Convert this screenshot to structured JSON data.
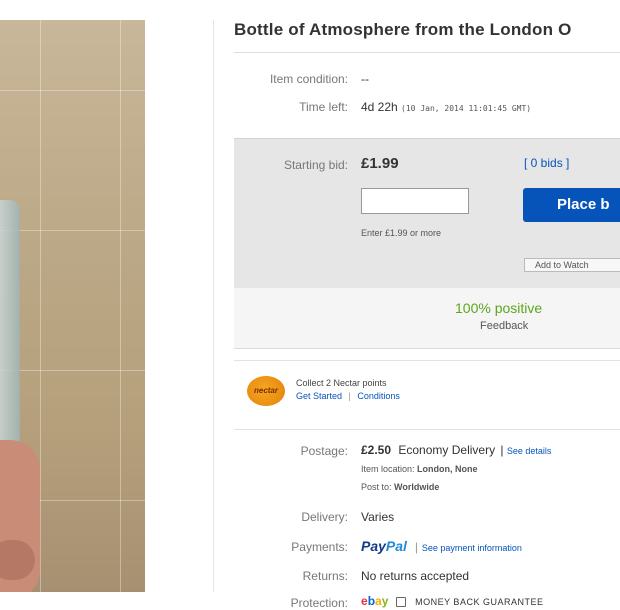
{
  "item": {
    "title": "Bottle of Atmosphere from the London O"
  },
  "details": {
    "condition_label": "Item condition:",
    "condition_value": "--",
    "time_left_label": "Time left:",
    "time_left_value": "4d 22h",
    "time_left_end": "(10 Jan, 2014  11:01:45 GMT)"
  },
  "bid": {
    "starting_label": "Starting bid:",
    "starting_price": "£1.99",
    "bids_link": "[ 0 bids ]",
    "input_value": "",
    "hint": "Enter £1.99 or more",
    "place_bid_label": "Place b",
    "watch_label": "Add to Watch"
  },
  "seller": {
    "positive": "100% positive",
    "feedback_label": "Feedback"
  },
  "nectar": {
    "logo_text": "nectar",
    "line1": "Collect 2 Nectar points",
    "get_started": "Get Started",
    "separator": "|",
    "conditions": "Conditions"
  },
  "postage": {
    "label": "Postage:",
    "price": "£2.50",
    "method": "Economy Delivery",
    "separator": "|",
    "see_details": "See details",
    "location_label": "Item location:",
    "location_value": "London, None",
    "post_to_label": "Post to:",
    "post_to_value": "Worldwide"
  },
  "delivery": {
    "label": "Delivery:",
    "value": "Varies"
  },
  "payments": {
    "label": "Payments:",
    "paypal_a": "Pay",
    "paypal_b": "Pal",
    "separator": "|",
    "see_payment": "See payment information"
  },
  "returns": {
    "label": "Returns:",
    "value": "No returns accepted"
  },
  "protection": {
    "label": "Protection:",
    "ebay_e": "e",
    "ebay_b": "b",
    "ebay_a": "a",
    "ebay_y": "y",
    "guarantee": "MONEY BACK GUARANTEE"
  },
  "colors": {
    "link": "#0654ba",
    "positive": "#5ba71b",
    "place_bid_bg": "#0654ba"
  }
}
